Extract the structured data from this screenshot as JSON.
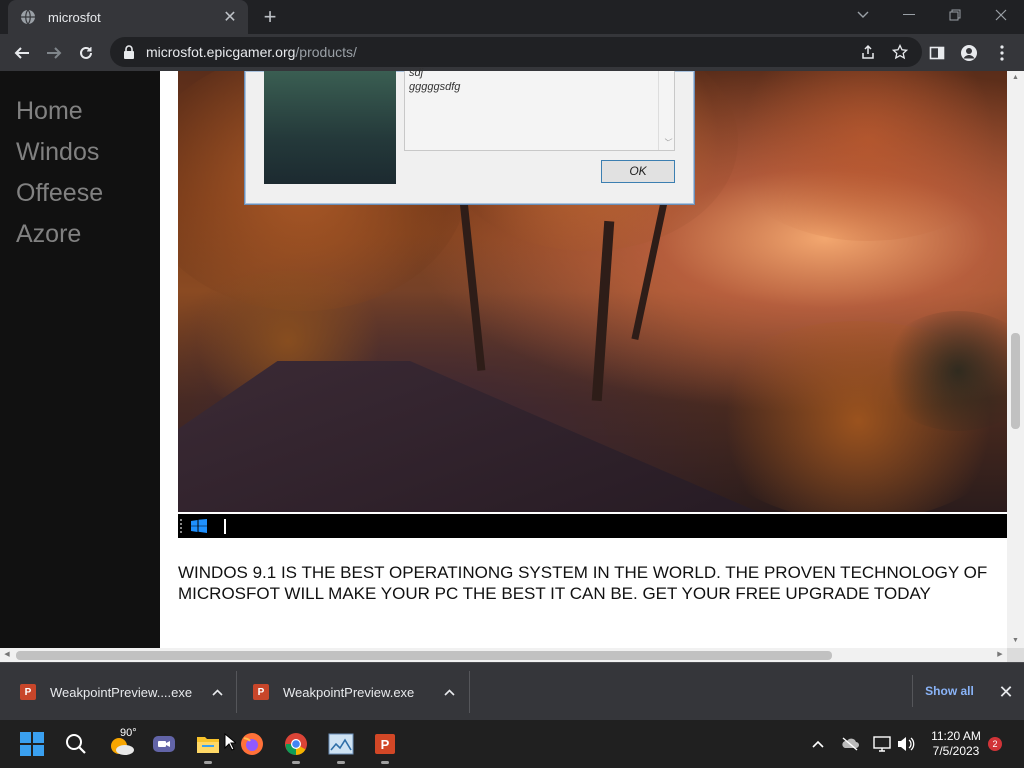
{
  "browser": {
    "tab_title": "microsfot",
    "tab_close": "✕",
    "new_tab": "+",
    "url_domain": "microsfot.epicgamer.org",
    "url_path": "/products/"
  },
  "sidebar": {
    "items": [
      {
        "label": "Home"
      },
      {
        "label": "Windos"
      },
      {
        "label": "Offeese"
      },
      {
        "label": "Azore"
      }
    ]
  },
  "dialog": {
    "text_line1": "sdj",
    "text_line2": "gggggsdfg",
    "ok_label": "OK"
  },
  "main": {
    "description": "WINDOS 9.1 IS THE BEST OPERATINONG SYSTEM IN THE WORLD. THE PROVEN TECHNOLOGY OF MICROSFOT WILL MAKE YOUR PC THE BEST IT CAN BE. GET YOUR FREE UPGRADE TODAY"
  },
  "downloads": {
    "items": [
      {
        "name": "WeakpointPreview....exe"
      },
      {
        "name": "WeakpointPreview.exe"
      }
    ],
    "show_all": "Show all"
  },
  "taskbar": {
    "weather_temp": "90°",
    "time": "11:20 AM",
    "date": "7/5/2023",
    "notification_count": "2",
    "icons": [
      "start-icon",
      "search-icon",
      "weather-icon",
      "teams-icon",
      "file-explorer-icon",
      "firefox-icon",
      "chrome-icon",
      "app-icon",
      "powerpoint-icon"
    ]
  },
  "colors": {
    "sidebar_bg": "#111111",
    "sidebar_link": "#818181",
    "accent_link": "#8ab4f8"
  }
}
